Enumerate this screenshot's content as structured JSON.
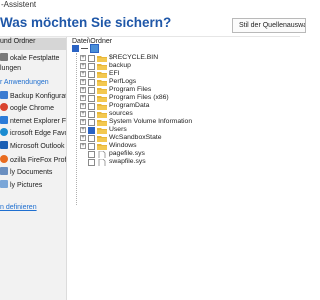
{
  "window": {
    "title": "-Assistent"
  },
  "heading": "Was möchten Sie sichern?",
  "style_button": "Stil der Quellenauswahl",
  "sidebar": {
    "items": [
      {
        "label": "und Ordner",
        "active": true,
        "icon": "none"
      },
      {
        "label": "okale Festplatte",
        "icon": "disk-icon"
      },
      {
        "label": "lungen",
        "icon": "none"
      },
      {
        "label": "r Anwendungen",
        "link": true,
        "icon": "none"
      },
      {
        "label": "Backup Konfigurationen",
        "icon": "config-icon"
      },
      {
        "label": "oogle Chrome",
        "icon": "chrome-icon"
      },
      {
        "label": "nternet Explorer Favorites",
        "icon": "ie-icon"
      },
      {
        "label": "icrosoft Edge Favorites",
        "icon": "edge-icon"
      },
      {
        "label": "Microsoft Outlook",
        "icon": "outlook-icon"
      },
      {
        "label": "ozilla FireFox Profiles",
        "icon": "firefox-icon"
      },
      {
        "label": "ly Documents",
        "icon": "documents-icon"
      },
      {
        "label": "ly Pictures",
        "icon": "pictures-icon"
      },
      {
        "label": "n definieren",
        "link": true,
        "underline": true,
        "icon": "none"
      }
    ]
  },
  "tree": {
    "header": "Datei\\Ordner",
    "items": [
      {
        "label": "$RECYCLE.BIN",
        "checked": "none",
        "expandable": true,
        "type": "folder"
      },
      {
        "label": "backup",
        "checked": "none",
        "expandable": true,
        "type": "folder"
      },
      {
        "label": "EFI",
        "checked": "none",
        "expandable": true,
        "type": "folder"
      },
      {
        "label": "PerfLogs",
        "checked": "none",
        "expandable": true,
        "type": "folder"
      },
      {
        "label": "Program Files",
        "checked": "none",
        "expandable": true,
        "type": "folder"
      },
      {
        "label": "Program Files (x86)",
        "checked": "none",
        "expandable": true,
        "type": "folder"
      },
      {
        "label": "ProgramData",
        "checked": "none",
        "expandable": true,
        "type": "folder"
      },
      {
        "label": "sources",
        "checked": "none",
        "expandable": true,
        "type": "folder"
      },
      {
        "label": "System Volume Information",
        "checked": "none",
        "expandable": true,
        "type": "folder"
      },
      {
        "label": "Users",
        "checked": "full",
        "expandable": true,
        "type": "folder"
      },
      {
        "label": "WcSandboxState",
        "checked": "none",
        "expandable": true,
        "type": "folder"
      },
      {
        "label": "Windows",
        "checked": "none",
        "expandable": true,
        "type": "folder"
      },
      {
        "label": "pagefile.sys",
        "checked": "none",
        "expandable": false,
        "type": "file"
      },
      {
        "label": "swapfile.sys",
        "checked": "none",
        "expandable": false,
        "type": "file"
      }
    ]
  },
  "colors": {
    "accent": "#1f57a8",
    "link": "#1f6fd0",
    "check": "#2a63c4",
    "folder": "#e8b73a"
  }
}
